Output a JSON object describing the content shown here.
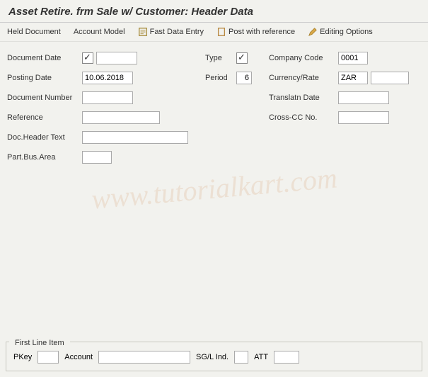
{
  "title": "Asset Retire. frm Sale w/ Customer: Header Data",
  "toolbar": {
    "held_document": "Held Document",
    "account_model": "Account Model",
    "fast_data_entry": "Fast Data Entry",
    "post_with_reference": "Post with reference",
    "editing_options": "Editing Options"
  },
  "fields": {
    "col1": {
      "document_date": {
        "label": "Document Date",
        "value": ""
      },
      "posting_date": {
        "label": "Posting Date",
        "value": "10.06.2018"
      },
      "document_number": {
        "label": "Document Number",
        "value": ""
      },
      "reference": {
        "label": "Reference",
        "value": ""
      },
      "doc_header_text": {
        "label": "Doc.Header Text",
        "value": ""
      },
      "part_bus_area": {
        "label": "Part.Bus.Area",
        "value": ""
      }
    },
    "col2": {
      "type": {
        "label": "Type",
        "value": ""
      },
      "period": {
        "label": "Period",
        "value": "6"
      }
    },
    "col3": {
      "company_code": {
        "label": "Company Code",
        "value": "0001"
      },
      "currency_rate": {
        "label": "Currency/Rate",
        "value": "ZAR",
        "value2": ""
      },
      "translatn_date": {
        "label": "Translatn Date",
        "value": ""
      },
      "cross_cc_no": {
        "label": "Cross-CC No.",
        "value": ""
      }
    }
  },
  "lineitem": {
    "title": "First Line Item",
    "pkey_label": "PKey",
    "pkey_value": "",
    "account_label": "Account",
    "account_value": "",
    "sgl_label": "SG/L Ind.",
    "sgl_value": "",
    "att_label": "ATT",
    "att_value": ""
  },
  "watermark": "www.tutorialkart.com"
}
